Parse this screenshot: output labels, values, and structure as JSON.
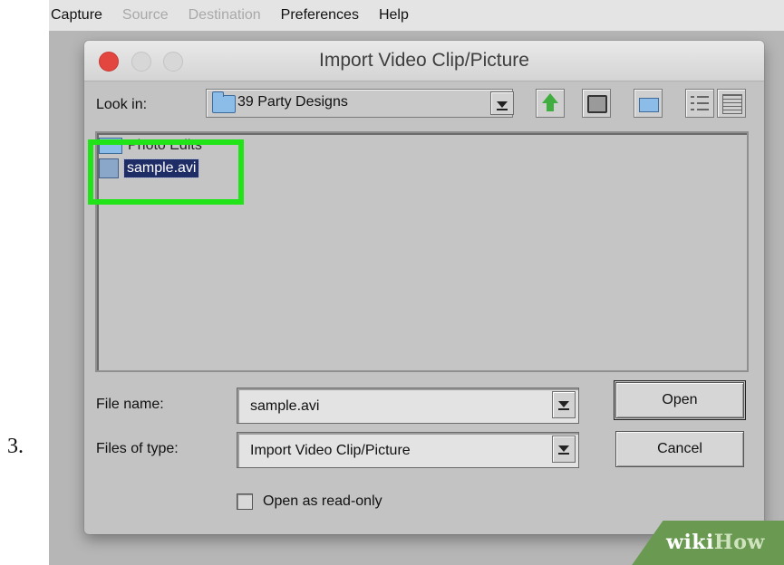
{
  "step_number": "3.",
  "menubar": {
    "items": [
      {
        "label": "Capture",
        "disabled": false
      },
      {
        "label": "Source",
        "disabled": true
      },
      {
        "label": "Destination",
        "disabled": true
      },
      {
        "label": "Preferences",
        "disabled": false
      },
      {
        "label": "Help",
        "disabled": false
      }
    ]
  },
  "dialog": {
    "title": "Import Video Clip/Picture",
    "look_in_label": "Look in:",
    "look_in_value": "39 Party Designs",
    "files": [
      {
        "name": "Photo Edits",
        "type": "folder",
        "selected": false
      },
      {
        "name": "sample.avi",
        "type": "file",
        "selected": true
      }
    ],
    "file_name_label": "File name:",
    "file_name_value": "sample.avi",
    "files_of_type_label": "Files of type:",
    "files_of_type_value": "Import Video Clip/Picture",
    "open_button": "Open",
    "cancel_button": "Cancel",
    "read_only_label": "Open as read-only",
    "read_only_checked": false
  },
  "watermark": {
    "part1": "wiki",
    "part2": "How"
  },
  "colors": {
    "highlight": "#21e418",
    "selection": "#1f2d67",
    "close": "#e2463f"
  }
}
